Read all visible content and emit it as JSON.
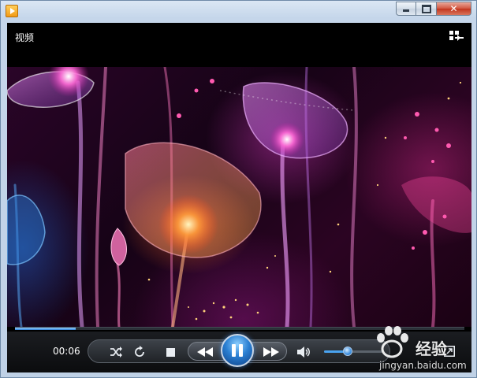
{
  "window": {
    "app_icon": "media-player-icon",
    "controls": [
      "minimize-icon",
      "maximize-icon",
      "close-icon"
    ]
  },
  "player": {
    "title": "视频",
    "layout_icon": "switch-to-library-icon"
  },
  "playback": {
    "current_time": "00:06",
    "progress": 0.135,
    "state": "playing",
    "volume": 0.4
  },
  "controls": {
    "shuffle_icon": "shuffle-icon",
    "repeat_icon": "repeat-icon",
    "stop_icon": "stop-icon",
    "previous_icon": "previous-icon",
    "play_pause_icon": "pause-icon",
    "next_icon": "next-icon",
    "mute_icon": "speaker-icon",
    "fullscreen_icon": "fullscreen-icon"
  },
  "watermark": {
    "brand": "经验",
    "url": "jingyan.baidu.com"
  },
  "colors": {
    "accent": "#2a7fd2",
    "player_bg": "#000000",
    "frame": "#bfd1e6"
  }
}
